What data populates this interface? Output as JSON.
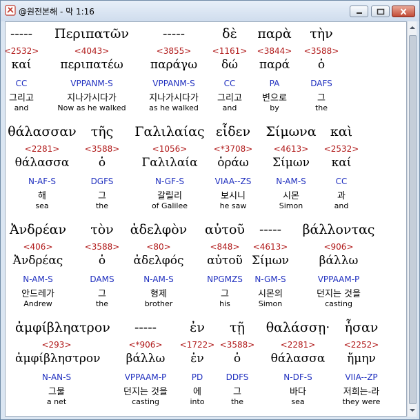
{
  "window": {
    "title": "@원전본해 - 막 1:16",
    "controls": {
      "minimize": "minimize",
      "maximize": "maximize",
      "close": "close"
    }
  },
  "lines": [
    {
      "words": [
        {
          "greek": "-----",
          "strong": "<2532>",
          "lemma": "καί",
          "morph": "CC",
          "korean": "그리고",
          "english": "and"
        },
        {
          "greek": "Περιπατῶν",
          "strong": "<4043>",
          "lemma": "περιπατέω",
          "morph": "VPPANM-S",
          "korean": "지나가시다가",
          "english": "Now as he walked"
        },
        {
          "greek": "-----",
          "strong": "<3855>",
          "lemma": "παράγω",
          "morph": "VPPANM-S",
          "korean": "지나가시다가",
          "english": "as he walked"
        },
        {
          "greek": "δὲ",
          "strong": "<1161>",
          "lemma": "δώ",
          "morph": "CC",
          "korean": "그리고",
          "english": "and"
        },
        {
          "greek": "παρὰ",
          "strong": "<3844>",
          "lemma": "παρά",
          "morph": "PA",
          "korean": "변으로",
          "english": "by"
        },
        {
          "greek": "τὴν",
          "strong": "<3588>",
          "lemma": "ὁ",
          "morph": "DAFS",
          "korean": "그",
          "english": "the"
        }
      ]
    },
    {
      "words": [
        {
          "greek": "θάλασσαν",
          "strong": "<2281>",
          "lemma": "θάλασσα",
          "morph": "N-AF-S",
          "korean": "해",
          "english": "sea"
        },
        {
          "greek": "τῆς",
          "strong": "<3588>",
          "lemma": "ὁ",
          "morph": "DGFS",
          "korean": "그",
          "english": "the"
        },
        {
          "greek": "Γαλιλαίας",
          "strong": "<1056>",
          "lemma": "Γαλιλαία",
          "morph": "N-GF-S",
          "korean": "갈릴리",
          "english": "of Galilee"
        },
        {
          "greek": "εἶδεν",
          "strong": "<*3708>",
          "lemma": "ὁράω",
          "morph": "VIAA--ZS",
          "korean": "보시니",
          "english": "he saw"
        },
        {
          "greek": "Σίμωνα",
          "strong": "<4613>",
          "lemma": "Σίμων",
          "morph": "N-AM-S",
          "korean": "시몬",
          "english": "Simon"
        },
        {
          "greek": "καὶ",
          "strong": "<2532>",
          "lemma": "καί",
          "morph": "CC",
          "korean": "과",
          "english": "and"
        }
      ]
    },
    {
      "words": [
        {
          "greek": "Ἀνδρέαν",
          "strong": "<406>",
          "lemma": "Ἀνδρέας",
          "morph": "N-AM-S",
          "korean": "안드레가",
          "english": "Andrew"
        },
        {
          "greek": "τὸν",
          "strong": "<3588>",
          "lemma": "ὁ",
          "morph": "DAMS",
          "korean": "그",
          "english": "the"
        },
        {
          "greek": "ἀδελφὸν",
          "strong": "<80>",
          "lemma": "ἀδελφός",
          "morph": "N-AM-S",
          "korean": "형제",
          "english": "brother"
        },
        {
          "greek": "αὐτοῦ",
          "strong": "<848>",
          "lemma": "αὐτοῦ",
          "morph": "NPGMZS",
          "korean": "그",
          "english": "his"
        },
        {
          "greek": "-----",
          "strong": "<4613>",
          "lemma": "Σίμων",
          "morph": "N-GM-S",
          "korean": "시몬의",
          "english": "Simon"
        },
        {
          "greek": "βάλλοντας",
          "strong": "<906>",
          "lemma": "βάλλω",
          "morph": "VPPAAM-P",
          "korean": "던지는 것을",
          "english": "casting"
        }
      ]
    },
    {
      "words": [
        {
          "greek": "ἀμφίβληατρον",
          "strong": "<293>",
          "lemma": "ἀμφίβληστρον",
          "morph": "N-AN-S",
          "korean": "그물",
          "english": "a net"
        },
        {
          "greek": "-----",
          "strong": "<*906>",
          "lemma": "βάλλω",
          "morph": "VPPAAM-P",
          "korean": "던지는 것을",
          "english": "casting"
        },
        {
          "greek": "ἐν",
          "strong": "<1722>",
          "lemma": "ἐν",
          "morph": "PD",
          "korean": "에",
          "english": "into"
        },
        {
          "greek": "τῇ",
          "strong": "<3588>",
          "lemma": "ὁ",
          "morph": "DDFS",
          "korean": "그",
          "english": "the"
        },
        {
          "greek": "θαλάσσῃ·",
          "strong": "<2281>",
          "lemma": "θάλασσα",
          "morph": "N-DF-S",
          "korean": "바다",
          "english": "sea"
        },
        {
          "greek": "ἦσαν",
          "strong": "<2252>",
          "lemma": "ἤμην",
          "morph": "VIIA--ZP",
          "korean": "저희는-라",
          "english": "they were"
        }
      ]
    }
  ]
}
